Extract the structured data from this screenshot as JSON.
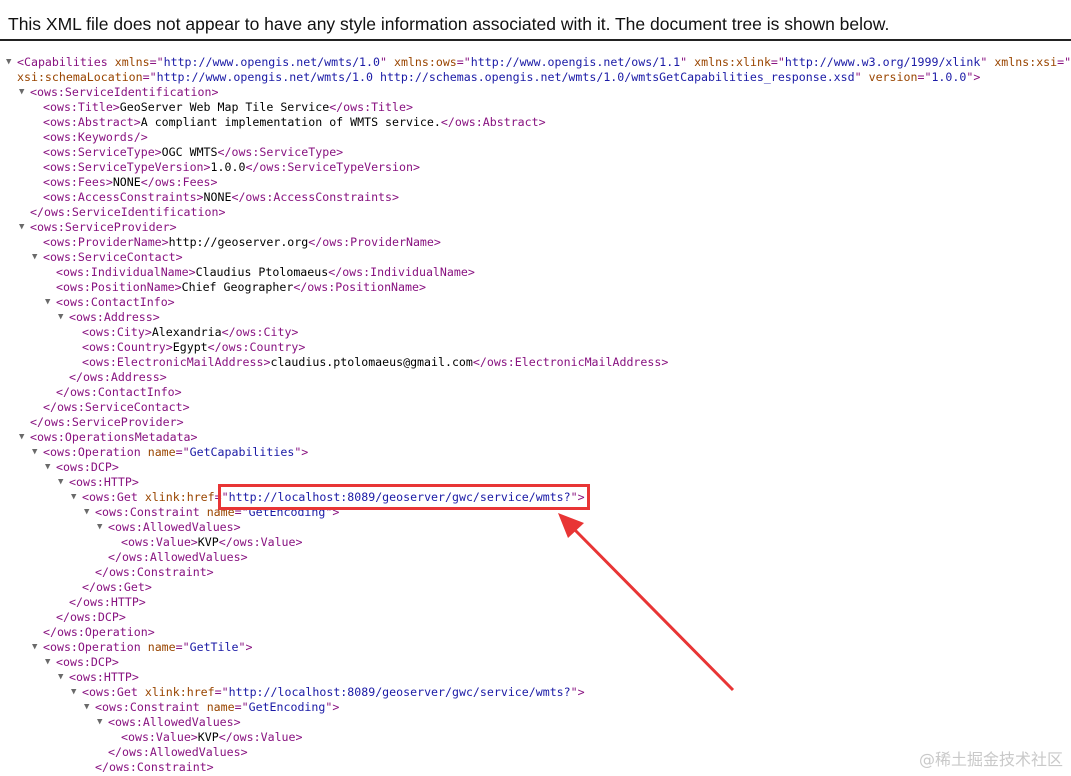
{
  "header": {
    "message": "This XML file does not appear to have any style information associated with it. The document tree is shown below."
  },
  "tree_lines": [
    {
      "indent": 0,
      "toggle": true,
      "parts": [
        [
          "punct",
          "<"
        ],
        [
          "tag",
          "Capabilities"
        ],
        [
          "txt",
          " "
        ],
        [
          "attr",
          "xmlns"
        ],
        [
          "punct",
          "=\""
        ],
        [
          "val",
          "http://www.opengis.net/wmts/1.0"
        ],
        [
          "punct",
          "\" "
        ],
        [
          "attr",
          "xmlns:ows"
        ],
        [
          "punct",
          "=\""
        ],
        [
          "val",
          "http://www.opengis.net/ows/1.1"
        ],
        [
          "punct",
          "\" "
        ],
        [
          "attr",
          "xmlns:xlink"
        ],
        [
          "punct",
          "=\""
        ],
        [
          "val",
          "http://www.w3.org/1999/xlink"
        ],
        [
          "punct",
          "\" "
        ],
        [
          "attr",
          "xmlns:xsi"
        ],
        [
          "punct",
          "=\""
        ]
      ]
    },
    {
      "indent": 0,
      "toggle": false,
      "parts": [
        [
          "attr",
          "xsi:schemaLocation"
        ],
        [
          "punct",
          "=\""
        ],
        [
          "val",
          "http://www.opengis.net/wmts/1.0 http://schemas.opengis.net/wmts/1.0/wmtsGetCapabilities_response.xsd"
        ],
        [
          "punct",
          "\" "
        ],
        [
          "attr",
          "version"
        ],
        [
          "punct",
          "=\""
        ],
        [
          "val",
          "1.0.0"
        ],
        [
          "punct",
          "\">"
        ]
      ]
    },
    {
      "indent": 1,
      "toggle": true,
      "parts": [
        [
          "tag",
          "<ows:ServiceIdentification>"
        ]
      ]
    },
    {
      "indent": 2,
      "toggle": false,
      "parts": [
        [
          "tag",
          "<ows:Title>"
        ],
        [
          "txt",
          "GeoServer Web Map Tile Service"
        ],
        [
          "tag",
          "</ows:Title>"
        ]
      ]
    },
    {
      "indent": 2,
      "toggle": false,
      "parts": [
        [
          "tag",
          "<ows:Abstract>"
        ],
        [
          "txt",
          "A compliant implementation of WMTS service."
        ],
        [
          "tag",
          "</ows:Abstract>"
        ]
      ]
    },
    {
      "indent": 2,
      "toggle": false,
      "parts": [
        [
          "tag",
          "<ows:Keywords/>"
        ]
      ]
    },
    {
      "indent": 2,
      "toggle": false,
      "parts": [
        [
          "tag",
          "<ows:ServiceType>"
        ],
        [
          "txt",
          "OGC WMTS"
        ],
        [
          "tag",
          "</ows:ServiceType>"
        ]
      ]
    },
    {
      "indent": 2,
      "toggle": false,
      "parts": [
        [
          "tag",
          "<ows:ServiceTypeVersion>"
        ],
        [
          "txt",
          "1.0.0"
        ],
        [
          "tag",
          "</ows:ServiceTypeVersion>"
        ]
      ]
    },
    {
      "indent": 2,
      "toggle": false,
      "parts": [
        [
          "tag",
          "<ows:Fees>"
        ],
        [
          "txt",
          "NONE"
        ],
        [
          "tag",
          "</ows:Fees>"
        ]
      ]
    },
    {
      "indent": 2,
      "toggle": false,
      "parts": [
        [
          "tag",
          "<ows:AccessConstraints>"
        ],
        [
          "txt",
          "NONE"
        ],
        [
          "tag",
          "</ows:AccessConstraints>"
        ]
      ]
    },
    {
      "indent": 1,
      "toggle": false,
      "parts": [
        [
          "tag",
          "</ows:ServiceIdentification>"
        ]
      ]
    },
    {
      "indent": 1,
      "toggle": true,
      "parts": [
        [
          "tag",
          "<ows:ServiceProvider>"
        ]
      ]
    },
    {
      "indent": 2,
      "toggle": false,
      "parts": [
        [
          "tag",
          "<ows:ProviderName>"
        ],
        [
          "txt",
          "http://geoserver.org"
        ],
        [
          "tag",
          "</ows:ProviderName>"
        ]
      ]
    },
    {
      "indent": 2,
      "toggle": true,
      "parts": [
        [
          "tag",
          "<ows:ServiceContact>"
        ]
      ]
    },
    {
      "indent": 3,
      "toggle": false,
      "parts": [
        [
          "tag",
          "<ows:IndividualName>"
        ],
        [
          "txt",
          "Claudius Ptolomaeus"
        ],
        [
          "tag",
          "</ows:IndividualName>"
        ]
      ]
    },
    {
      "indent": 3,
      "toggle": false,
      "parts": [
        [
          "tag",
          "<ows:PositionName>"
        ],
        [
          "txt",
          "Chief Geographer"
        ],
        [
          "tag",
          "</ows:PositionName>"
        ]
      ]
    },
    {
      "indent": 3,
      "toggle": true,
      "parts": [
        [
          "tag",
          "<ows:ContactInfo>"
        ]
      ]
    },
    {
      "indent": 4,
      "toggle": true,
      "parts": [
        [
          "tag",
          "<ows:Address>"
        ]
      ]
    },
    {
      "indent": 5,
      "toggle": false,
      "parts": [
        [
          "tag",
          "<ows:City>"
        ],
        [
          "txt",
          "Alexandria"
        ],
        [
          "tag",
          "</ows:City>"
        ]
      ]
    },
    {
      "indent": 5,
      "toggle": false,
      "parts": [
        [
          "tag",
          "<ows:Country>"
        ],
        [
          "txt",
          "Egypt"
        ],
        [
          "tag",
          "</ows:Country>"
        ]
      ]
    },
    {
      "indent": 5,
      "toggle": false,
      "parts": [
        [
          "tag",
          "<ows:ElectronicMailAddress>"
        ],
        [
          "txt",
          "claudius.ptolomaeus@gmail.com"
        ],
        [
          "tag",
          "</ows:ElectronicMailAddress>"
        ]
      ]
    },
    {
      "indent": 4,
      "toggle": false,
      "parts": [
        [
          "tag",
          "</ows:Address>"
        ]
      ]
    },
    {
      "indent": 3,
      "toggle": false,
      "parts": [
        [
          "tag",
          "</ows:ContactInfo>"
        ]
      ]
    },
    {
      "indent": 2,
      "toggle": false,
      "parts": [
        [
          "tag",
          "</ows:ServiceContact>"
        ]
      ]
    },
    {
      "indent": 1,
      "toggle": false,
      "parts": [
        [
          "tag",
          "</ows:ServiceProvider>"
        ]
      ]
    },
    {
      "indent": 1,
      "toggle": true,
      "parts": [
        [
          "tag",
          "<ows:OperationsMetadata>"
        ]
      ]
    },
    {
      "indent": 2,
      "toggle": true,
      "parts": [
        [
          "punct",
          "<"
        ],
        [
          "tag",
          "ows:Operation"
        ],
        [
          "txt",
          " "
        ],
        [
          "attr",
          "name"
        ],
        [
          "punct",
          "=\""
        ],
        [
          "val",
          "GetCapabilities"
        ],
        [
          "punct",
          "\">"
        ]
      ]
    },
    {
      "indent": 3,
      "toggle": true,
      "parts": [
        [
          "tag",
          "<ows:DCP>"
        ]
      ]
    },
    {
      "indent": 4,
      "toggle": true,
      "parts": [
        [
          "tag",
          "<ows:HTTP>"
        ]
      ]
    },
    {
      "indent": 5,
      "toggle": true,
      "parts": [
        [
          "punct",
          "<"
        ],
        [
          "tag",
          "ows:Get"
        ],
        [
          "txt",
          " "
        ],
        [
          "attr",
          "xlink:href"
        ],
        [
          "punct",
          "=\""
        ],
        [
          "val",
          "http://localhost:8089/geoserver/gwc/service/wmts?"
        ],
        [
          "punct",
          "\">"
        ]
      ]
    },
    {
      "indent": 6,
      "toggle": true,
      "parts": [
        [
          "punct",
          "<"
        ],
        [
          "tag",
          "ows:Constraint"
        ],
        [
          "txt",
          " "
        ],
        [
          "attr",
          "name"
        ],
        [
          "punct",
          "=\""
        ],
        [
          "val",
          "GetEncoding"
        ],
        [
          "punct",
          "\">"
        ]
      ]
    },
    {
      "indent": 7,
      "toggle": true,
      "parts": [
        [
          "tag",
          "<ows:AllowedValues>"
        ]
      ]
    },
    {
      "indent": 8,
      "toggle": false,
      "parts": [
        [
          "tag",
          "<ows:Value>"
        ],
        [
          "txt",
          "KVP"
        ],
        [
          "tag",
          "</ows:Value>"
        ]
      ]
    },
    {
      "indent": 7,
      "toggle": false,
      "parts": [
        [
          "tag",
          "</ows:AllowedValues>"
        ]
      ]
    },
    {
      "indent": 6,
      "toggle": false,
      "parts": [
        [
          "tag",
          "</ows:Constraint>"
        ]
      ]
    },
    {
      "indent": 5,
      "toggle": false,
      "parts": [
        [
          "tag",
          "</ows:Get>"
        ]
      ]
    },
    {
      "indent": 4,
      "toggle": false,
      "parts": [
        [
          "tag",
          "</ows:HTTP>"
        ]
      ]
    },
    {
      "indent": 3,
      "toggle": false,
      "parts": [
        [
          "tag",
          "</ows:DCP>"
        ]
      ]
    },
    {
      "indent": 2,
      "toggle": false,
      "parts": [
        [
          "tag",
          "</ows:Operation>"
        ]
      ]
    },
    {
      "indent": 2,
      "toggle": true,
      "parts": [
        [
          "punct",
          "<"
        ],
        [
          "tag",
          "ows:Operation"
        ],
        [
          "txt",
          " "
        ],
        [
          "attr",
          "name"
        ],
        [
          "punct",
          "=\""
        ],
        [
          "val",
          "GetTile"
        ],
        [
          "punct",
          "\">"
        ]
      ]
    },
    {
      "indent": 3,
      "toggle": true,
      "parts": [
        [
          "tag",
          "<ows:DCP>"
        ]
      ]
    },
    {
      "indent": 4,
      "toggle": true,
      "parts": [
        [
          "tag",
          "<ows:HTTP>"
        ]
      ]
    },
    {
      "indent": 5,
      "toggle": true,
      "parts": [
        [
          "punct",
          "<"
        ],
        [
          "tag",
          "ows:Get"
        ],
        [
          "txt",
          " "
        ],
        [
          "attr",
          "xlink:href"
        ],
        [
          "punct",
          "=\""
        ],
        [
          "val",
          "http://localhost:8089/geoserver/gwc/service/wmts?"
        ],
        [
          "punct",
          "\">"
        ]
      ]
    },
    {
      "indent": 6,
      "toggle": true,
      "parts": [
        [
          "punct",
          "<"
        ],
        [
          "tag",
          "ows:Constraint"
        ],
        [
          "txt",
          " "
        ],
        [
          "attr",
          "name"
        ],
        [
          "punct",
          "=\""
        ],
        [
          "val",
          "GetEncoding"
        ],
        [
          "punct",
          "\">"
        ]
      ]
    },
    {
      "indent": 7,
      "toggle": true,
      "parts": [
        [
          "tag",
          "<ows:AllowedValues>"
        ]
      ]
    },
    {
      "indent": 8,
      "toggle": false,
      "parts": [
        [
          "tag",
          "<ows:Value>"
        ],
        [
          "txt",
          "KVP"
        ],
        [
          "tag",
          "</ows:Value>"
        ]
      ]
    },
    {
      "indent": 7,
      "toggle": false,
      "parts": [
        [
          "tag",
          "</ows:AllowedValues>"
        ]
      ]
    },
    {
      "indent": 6,
      "toggle": false,
      "parts": [
        [
          "tag",
          "</ows:Constraint>"
        ]
      ]
    }
  ],
  "annotation": {
    "highlight_color": "#e83535"
  },
  "watermark": "@稀土掘金技术社区",
  "icons": {
    "expand_toggle": "triangle-down-icon"
  },
  "colors": {
    "tag": "#881280",
    "attribute": "#994500",
    "value": "#1a1aa6",
    "text": "#000000"
  }
}
